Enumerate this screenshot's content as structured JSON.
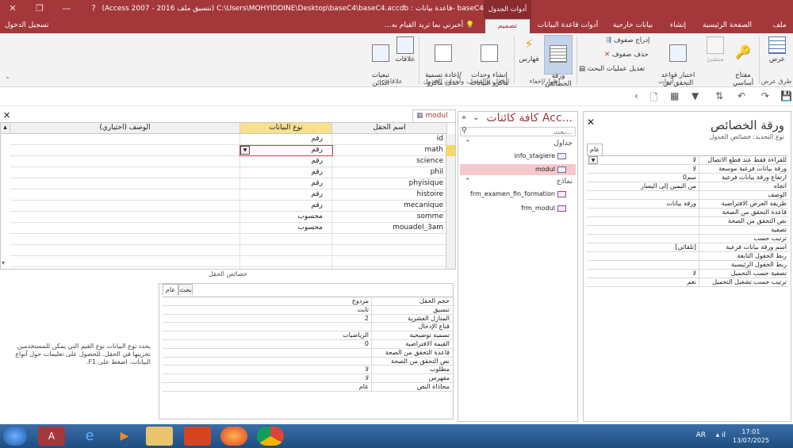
{
  "window": {
    "title": "(Access 2007 - 2016 تنسيق ملف) C:\\Users\\MOHYIDDINE\\Desktop\\baseC4\\baseC4.accdb : قاعدة بيانات- baseC4",
    "context_header": "أدوات الجدول",
    "controls": {
      "close": "✕",
      "restore": "❐",
      "minimize": "—",
      "help": "?"
    }
  },
  "tabs": {
    "file": "ملف",
    "home": "الصفحة الرئيسية",
    "create": "إنشاء",
    "external": "بيانات خارجية",
    "dbtools": "أدوات قاعدة البيانات",
    "design": "تصميم",
    "tell_me": "أخبرني بما تريد القيام به...",
    "sign_in": "تسجيل الدخول"
  },
  "ribbon": {
    "view": "عرض",
    "views_group": "طرق عرض",
    "primary_key": "مفتاح\nأساسي",
    "builder": "منشئ",
    "test_rules": "اختبار قواعد\nالتحقق من الصحة",
    "insert_rows": "إدراج صفوف",
    "delete_rows": "حذف صفوف",
    "modify_lookups": "تعديل عمليات البحث",
    "tools_group": "أدوات",
    "property_sheet": "ورقة\nالخصائص",
    "indexes": "فهارس",
    "showhide_group": "إظهار/إخفاء",
    "create_macros": "إنشاء وحدات\nماكرو البيانات",
    "rename_macro": "إعادة تسمية/\nحذف ماكرو",
    "events_group": "الحقل، والسجل، وأحداث الجدول",
    "relationships": "علاقات",
    "dependencies": "تبعيات\nالكائن",
    "relationships_group": "علاقات"
  },
  "nav": {
    "title": "كافة كائنات Acc...",
    "search_placeholder": "بحث...",
    "sections": [
      {
        "label": "جداول",
        "items": [
          "info_stagiere",
          "modul"
        ]
      },
      {
        "label": "نماذج",
        "items": [
          "frm_examen_fin_formation",
          "frm_modul"
        ]
      }
    ]
  },
  "document_tab": "modul",
  "grid": {
    "headers": {
      "field_name": "اسم الحقل",
      "data_type": "نوع البيانات",
      "description": "الوصف (اختياري)"
    },
    "rows": [
      {
        "field": "id",
        "type": "رقم"
      },
      {
        "field": "math",
        "type": "رقم"
      },
      {
        "field": "science",
        "type": "رقم"
      },
      {
        "field": "phil",
        "type": "رقم"
      },
      {
        "field": "phyisique",
        "type": "رقم"
      },
      {
        "field": "histoire",
        "type": "رقم"
      },
      {
        "field": "mecanique",
        "type": "رقم"
      },
      {
        "field": "somme",
        "type": "محسوب"
      },
      {
        "field": "mouadel_3am",
        "type": "محسوب"
      }
    ]
  },
  "field_props": {
    "label": "خصائص الحقل",
    "tab_general": "عام",
    "tab_lookup": "بحث",
    "rows": [
      {
        "k": "حجم الحقل",
        "v": "مزدوج"
      },
      {
        "k": "تنسيق",
        "v": "ثابت"
      },
      {
        "k": "المنازل العشرية",
        "v": "2"
      },
      {
        "k": "قناع الإدخال",
        "v": ""
      },
      {
        "k": "تسمية توضيحية",
        "v": "الرياضيات"
      },
      {
        "k": "القيمة الافتراضية",
        "v": "0"
      },
      {
        "k": "قاعدة التحقق من الصحة",
        "v": ""
      },
      {
        "k": "نص التحقق من الصحة",
        "v": ""
      },
      {
        "k": "مطلوب",
        "v": "لا"
      },
      {
        "k": "مفهرس",
        "v": "لا"
      },
      {
        "k": "محاذاة النص",
        "v": "عام"
      }
    ],
    "help": "يحدد نوع البيانات نوع القيم التي يمكن للمستخدمين تخزينها في الحقل. للحصول على تعليمات حول أنواع البيانات، اضغط على F1."
  },
  "prop_sheet": {
    "title": "ورقة الخصائص",
    "subtitle": "نوع التحديد: خصائص الجدول",
    "tab": "عام",
    "rows": [
      {
        "k": "للقراءة فقط عند قطع الاتصال",
        "v": "لا"
      },
      {
        "k": "ورقة بيانات فرعية موسعة",
        "v": "لا"
      },
      {
        "k": "ارتفاع ورقة بيانات فرعية",
        "v": "0سم"
      },
      {
        "k": "اتجاه",
        "v": "من اليمين إلى اليسار"
      },
      {
        "k": "الوصف",
        "v": ""
      },
      {
        "k": "طريقة العرض الافتراضية",
        "v": "ورقة بيانات"
      },
      {
        "k": "قاعدة التحقق من الصحة",
        "v": ""
      },
      {
        "k": "نص التحقق من الصحة",
        "v": ""
      },
      {
        "k": "تصفية",
        "v": ""
      },
      {
        "k": "ترتيب حسب",
        "v": ""
      },
      {
        "k": "اسم ورقة بيانات فرعية",
        "v": "[تلقائي]"
      },
      {
        "k": "ربط الحقول التابعة",
        "v": ""
      },
      {
        "k": "ربط الحقول الرئيسية",
        "v": ""
      },
      {
        "k": "تصفية حسب التحميل",
        "v": "لا"
      },
      {
        "k": "ترتيب حسب تشغيل التحميل",
        "v": "نعم"
      }
    ]
  },
  "taskbar": {
    "lang": "AR",
    "time": "17:01",
    "date": "13/07/2025"
  }
}
